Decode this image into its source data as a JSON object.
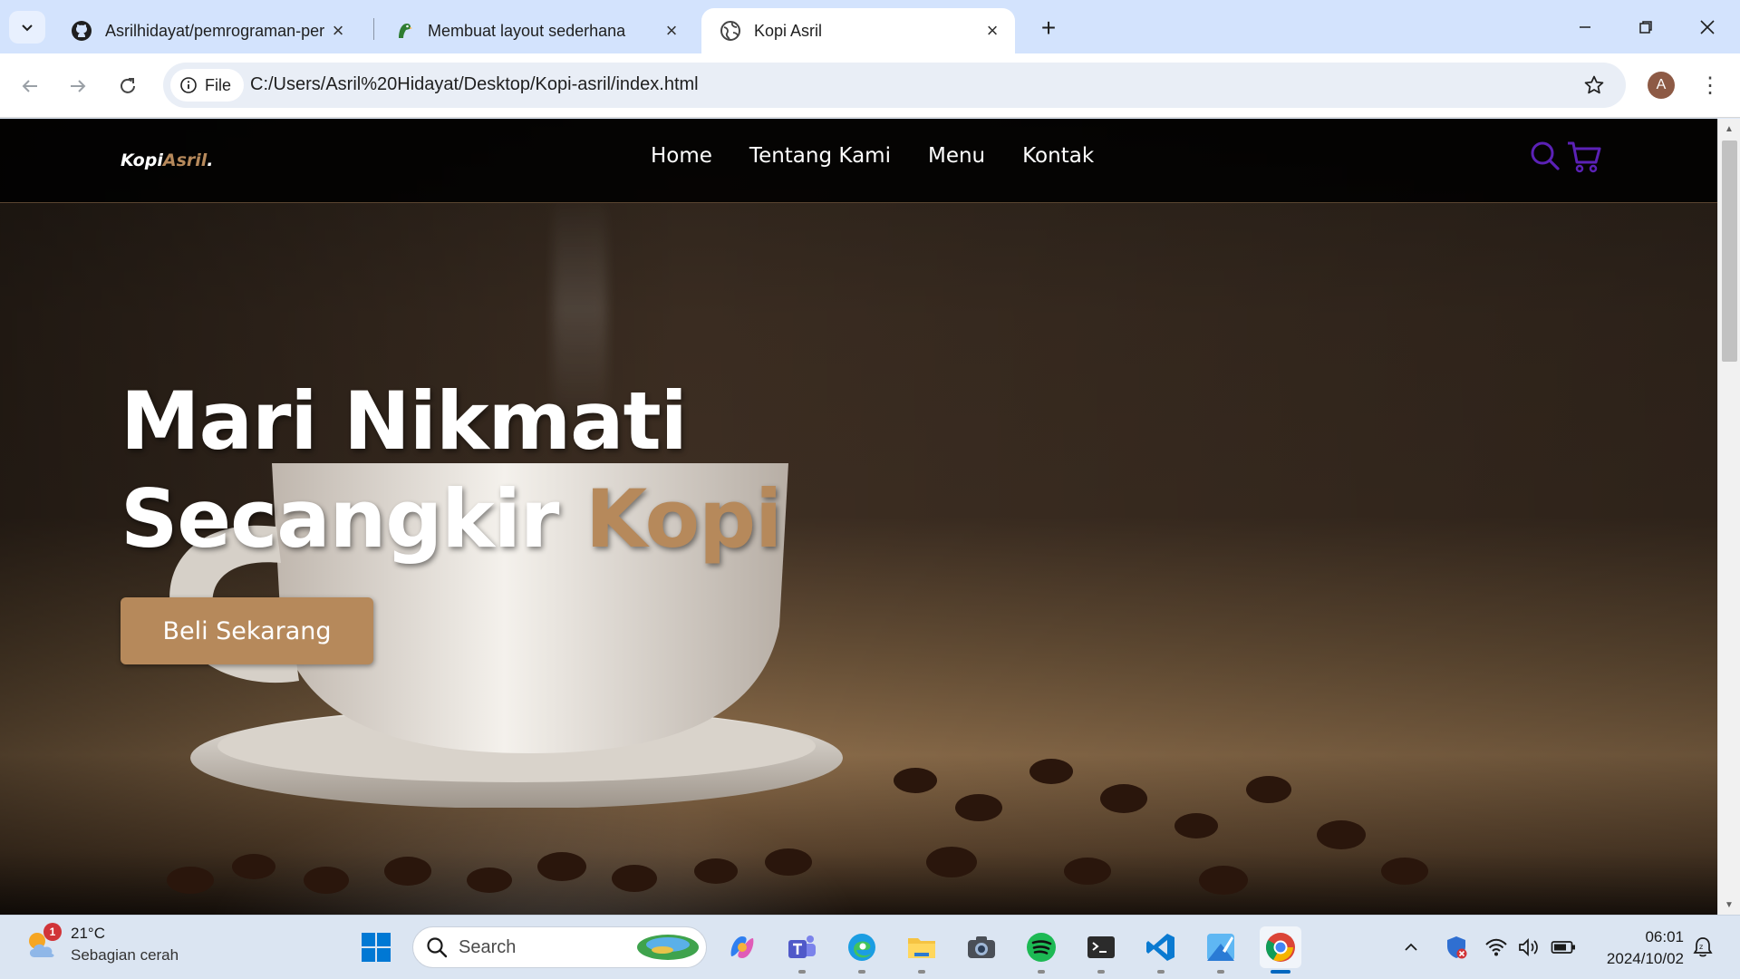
{
  "browser": {
    "tabs": [
      {
        "title": "Asrilhidayat/pemrograman-per",
        "icon": "github-icon"
      },
      {
        "title": "Membuat layout sederhana",
        "icon": "parrot-icon"
      },
      {
        "title": "Kopi Asril",
        "icon": "globe-icon",
        "active": true
      }
    ],
    "chip_label": "File",
    "url": "C:/Users/Asril%20Hidayat/Desktop/Kopi-asril/index.html",
    "profile_initial": "A"
  },
  "site": {
    "logo_main": "Kopi",
    "logo_accent": "Asril",
    "logo_dot": ".",
    "nav": [
      "Home",
      "Tentang Kami",
      "Menu",
      "Kontak"
    ],
    "hero_line1": "Mari Nikmati",
    "hero_line2_white": "Secangkir ",
    "hero_line2_accent": "Kopi",
    "cta_label": "Beli Sekarang",
    "accent_color": "#b6895b",
    "icon_color": "#5b21b6"
  },
  "taskbar": {
    "weather_temp": "21°C",
    "weather_desc": "Sebagian cerah",
    "weather_badge": "1",
    "search_placeholder": "Search",
    "time": "06:01",
    "date": "2024/10/02"
  }
}
